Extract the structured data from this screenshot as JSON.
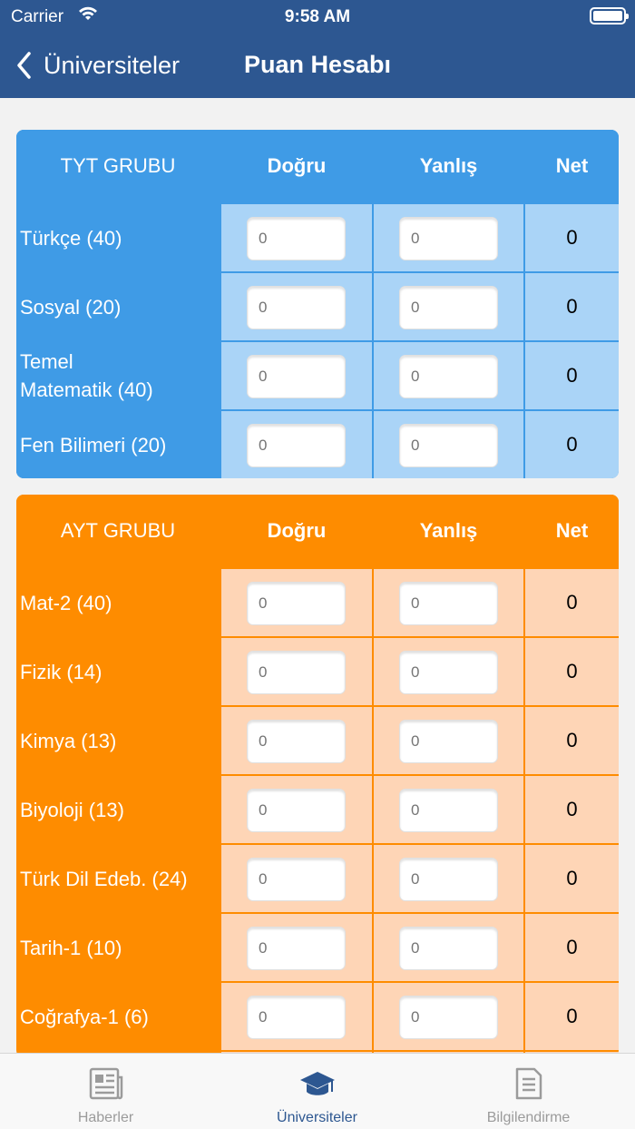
{
  "status_bar": {
    "carrier": "Carrier",
    "time": "9:58 AM"
  },
  "nav": {
    "back_label": "Üniversiteler",
    "title": "Puan Hesabı"
  },
  "tyt": {
    "header": {
      "group": "TYT GRUBU",
      "correct": "Doğru",
      "wrong": "Yanlış",
      "net": "Net"
    },
    "rows": [
      {
        "subject": "Türkçe (40)",
        "correct_placeholder": "0",
        "wrong_placeholder": "0",
        "net": "0"
      },
      {
        "subject": "Sosyal (20)",
        "correct_placeholder": "0",
        "wrong_placeholder": "0",
        "net": "0"
      },
      {
        "subject": "Temel Matematik (40)",
        "correct_placeholder": "0",
        "wrong_placeholder": "0",
        "net": "0"
      },
      {
        "subject": "Fen Bilimeri (20)",
        "correct_placeholder": "0",
        "wrong_placeholder": "0",
        "net": "0"
      }
    ]
  },
  "ayt": {
    "header": {
      "group": "AYT GRUBU",
      "correct": "Doğru",
      "wrong": "Yanlış",
      "net": "Net"
    },
    "rows": [
      {
        "subject": "Mat-2 (40)",
        "correct_placeholder": "0",
        "wrong_placeholder": "0",
        "net": "0"
      },
      {
        "subject": "Fizik (14)",
        "correct_placeholder": "0",
        "wrong_placeholder": "0",
        "net": "0"
      },
      {
        "subject": "Kimya (13)",
        "correct_placeholder": "0",
        "wrong_placeholder": "0",
        "net": "0"
      },
      {
        "subject": "Biyoloji (13)",
        "correct_placeholder": "0",
        "wrong_placeholder": "0",
        "net": "0"
      },
      {
        "subject": "Türk Dil Edeb. (24)",
        "correct_placeholder": "0",
        "wrong_placeholder": "0",
        "net": "0"
      },
      {
        "subject": "Tarih-1 (10)",
        "correct_placeholder": "0",
        "wrong_placeholder": "0",
        "net": "0"
      },
      {
        "subject": "Coğrafya-1 (6)",
        "correct_placeholder": "0",
        "wrong_placeholder": "0",
        "net": "0"
      }
    ]
  },
  "tabbar": {
    "tabs": [
      {
        "label": "Haberler",
        "icon": "newspaper-icon",
        "active": false
      },
      {
        "label": "Üniversiteler",
        "icon": "graduation-cap-icon",
        "active": true
      },
      {
        "label": "Bilgilendirme",
        "icon": "document-icon",
        "active": false
      }
    ]
  },
  "colors": {
    "nav_bg": "#2d5791",
    "tyt_primary": "#3f9be6",
    "tyt_light": "#aad4f7",
    "ayt_primary": "#fe8c00",
    "ayt_light": "#fed5b6"
  }
}
